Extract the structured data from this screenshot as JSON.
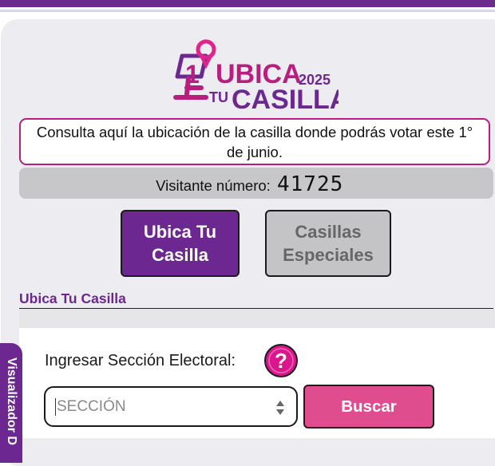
{
  "logo": {
    "number": "1",
    "line1": "UBICA",
    "year": "2025",
    "line2_small": "TU",
    "line2": "CASILLA"
  },
  "consulta_text": "Consulta aquí la ubicación de la casilla donde podrás votar este 1° de junio.",
  "visitor": {
    "label": "Visitante número:",
    "count": "41725"
  },
  "buttons": {
    "ubica": "Ubica Tu Casilla",
    "casillas": "Casillas Especiales"
  },
  "section": {
    "title": "Ubica Tu Casilla"
  },
  "form": {
    "label": "Ingresar Sección Electoral:",
    "help_icon": "question-icon",
    "select_placeholder": "SECCIÓN",
    "search_button": "Buscar"
  },
  "side_tab": "Visualizador D",
  "colors": {
    "brand_purple": "#6c2890",
    "magenta": "#b81e7e",
    "pink_button": "#e04d8f"
  }
}
